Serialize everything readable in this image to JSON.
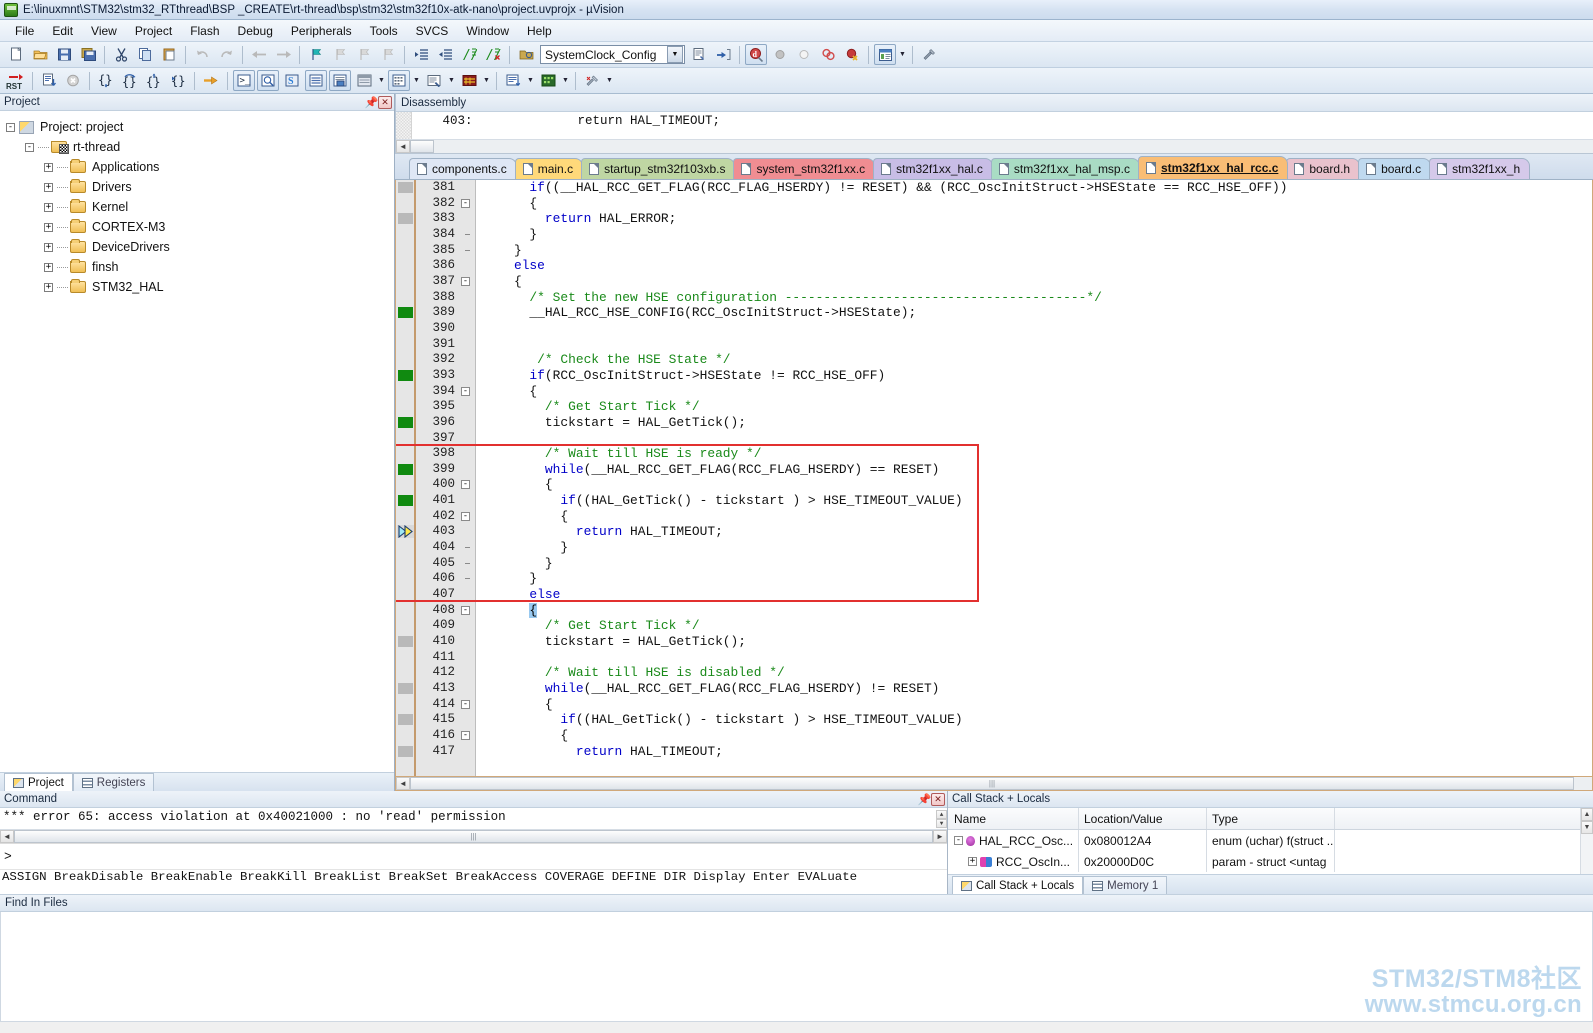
{
  "window": {
    "title": "E:\\linuxmnt\\STM32\\stm32_RTthread\\BSP _CREATE\\rt-thread\\bsp\\stm32\\stm32f10x-atk-nano\\project.uvprojx - µVision",
    "app_icon": "keil-uvision-icon"
  },
  "menu": [
    {
      "label": "File"
    },
    {
      "label": "Edit"
    },
    {
      "label": "View"
    },
    {
      "label": "Project"
    },
    {
      "label": "Flash"
    },
    {
      "label": "Debug"
    },
    {
      "label": "Peripherals"
    },
    {
      "label": "Tools"
    },
    {
      "label": "SVCS"
    },
    {
      "label": "Window"
    },
    {
      "label": "Help"
    }
  ],
  "toolbar": {
    "function_combo_value": "SystemClock_Config",
    "row1_icons": [
      "new-file-icon",
      "open-file-icon",
      "save-icon",
      "save-all-icon",
      "sep",
      "cut-icon",
      "copy-icon",
      "paste-icon",
      "sep",
      "undo-icon",
      "redo-icon",
      "sep",
      "navigate-back-icon",
      "navigate-forward-icon",
      "sep",
      "bookmark-toggle-icon",
      "bookmark-prev-icon",
      "bookmark-next-icon",
      "bookmark-clear-icon",
      "sep",
      "indent-icon",
      "outdent-icon",
      "comment-icon",
      "uncomment-icon"
    ],
    "row2_icons": [
      "reset-cpu-icon",
      "sep",
      "build-icon",
      "stop-build-icon",
      "sep",
      "step-into-icon",
      "step-over-icon",
      "step-out-icon",
      "run-to-cursor-icon",
      "sep",
      "show-next-statement-icon",
      "sep",
      "command-window-icon",
      "disassembly-window-icon",
      "symbols-window-icon",
      "registers-window-icon",
      "call-stack-window-icon",
      "watch-window-icon",
      "watch-caret",
      "memory-window-icon",
      "memory-caret",
      "serial-window-icon",
      "serial-caret",
      "analysis-window-icon",
      "analysis-caret"
    ],
    "right_icons": [
      "sep",
      "target-options-icon",
      "function-combo",
      "bookmark-list-icon",
      "go-to-definition-icon",
      "sep",
      "start-debug-icon",
      "insert-breakpoint-icon",
      "disable-breakpoint-icon",
      "kill-all-breakpoints-icon",
      "disable-all-breakpoints-icon",
      "sep",
      "manage-windows-icon",
      "manage-caret",
      "sep",
      "configure-icon"
    ]
  },
  "project_panel": {
    "title": "Project",
    "pin_icon": "pin-icon",
    "close_icon": "close-icon",
    "tree": [
      {
        "label": "Project: project",
        "depth": 0,
        "expander": "-",
        "icon": "project-icon"
      },
      {
        "label": "rt-thread",
        "depth": 1,
        "expander": "-",
        "icon": "target-icon"
      },
      {
        "label": "Applications",
        "depth": 2,
        "expander": "+",
        "icon": "folder-icon"
      },
      {
        "label": "Drivers",
        "depth": 2,
        "expander": "+",
        "icon": "folder-icon"
      },
      {
        "label": "Kernel",
        "depth": 2,
        "expander": "+",
        "icon": "folder-icon"
      },
      {
        "label": "CORTEX-M3",
        "depth": 2,
        "expander": "+",
        "icon": "folder-icon"
      },
      {
        "label": "DeviceDrivers",
        "depth": 2,
        "expander": "+",
        "icon": "folder-icon"
      },
      {
        "label": "finsh",
        "depth": 2,
        "expander": "+",
        "icon": "folder-icon"
      },
      {
        "label": "STM32_HAL",
        "depth": 2,
        "expander": "+",
        "icon": "folder-icon"
      }
    ],
    "tabs": [
      {
        "label": "Project",
        "active": true,
        "icon": "project-tab-icon"
      },
      {
        "label": "Registers",
        "active": false,
        "icon": "registers-tab-icon"
      }
    ]
  },
  "disassembly": {
    "title": "Disassembly",
    "line": "   403:              return HAL_TIMEOUT;"
  },
  "file_tabs": [
    {
      "label": "components.c",
      "color": "#dfe7f5",
      "active": false
    },
    {
      "label": "main.c",
      "color": "#ffd97a",
      "active": false
    },
    {
      "label": "startup_stm32f103xb.s",
      "color": "#bfd6a3",
      "active": false
    },
    {
      "label": "system_stm32f1xx.c",
      "color": "#f08d92",
      "active": false
    },
    {
      "label": "stm32f1xx_hal.c",
      "color": "#c8bde6",
      "active": false
    },
    {
      "label": "stm32f1xx_hal_msp.c",
      "color": "#a9dcc4",
      "active": false
    },
    {
      "label": "stm32f1xx_hal_rcc.c",
      "color": "#f9bd75",
      "active": true
    },
    {
      "label": "board.h",
      "color": "#e9c2cd",
      "active": false
    },
    {
      "label": "board.c",
      "color": "#bfd9ef",
      "active": false
    },
    {
      "label": "stm32f1xx_h",
      "color": "#d5c9ea",
      "active": false
    }
  ],
  "editor": {
    "highlight_box": {
      "label": "red-annotation-rectangle"
    },
    "lines": [
      {
        "num": 381,
        "marker": "grey",
        "fold": "none",
        "text": "      if((__HAL_RCC_GET_FLAG(RCC_FLAG_HSERDY) != RESET) && (RCC_OscInitStruct->HSEState == RCC_HSE_OFF))",
        "kw": "if"
      },
      {
        "num": 382,
        "marker": "none",
        "fold": "minus",
        "text": "      {"
      },
      {
        "num": 383,
        "marker": "grey",
        "fold": "none",
        "text": "        return HAL_ERROR;",
        "kw": "return"
      },
      {
        "num": 384,
        "marker": "none",
        "fold": "tick",
        "text": "      }"
      },
      {
        "num": 385,
        "marker": "none",
        "fold": "tick",
        "text": "    }"
      },
      {
        "num": 386,
        "marker": "none",
        "fold": "none",
        "text": "    else",
        "kw": "else"
      },
      {
        "num": 387,
        "marker": "none",
        "fold": "minus",
        "text": "    {"
      },
      {
        "num": 388,
        "marker": "none",
        "fold": "none",
        "text": "      /* Set the new HSE configuration ---------------------------------------*/",
        "comment": true
      },
      {
        "num": 389,
        "marker": "green",
        "fold": "none",
        "text": "      __HAL_RCC_HSE_CONFIG(RCC_OscInitStruct->HSEState);"
      },
      {
        "num": 390,
        "marker": "none",
        "fold": "none",
        "text": ""
      },
      {
        "num": 391,
        "marker": "none",
        "fold": "none",
        "text": ""
      },
      {
        "num": 392,
        "marker": "none",
        "fold": "none",
        "text": "       /* Check the HSE State */",
        "comment": true
      },
      {
        "num": 393,
        "marker": "green",
        "fold": "none",
        "text": "      if(RCC_OscInitStruct->HSEState != RCC_HSE_OFF)",
        "kw": "if"
      },
      {
        "num": 394,
        "marker": "none",
        "fold": "minus",
        "text": "      {"
      },
      {
        "num": 395,
        "marker": "none",
        "fold": "none",
        "text": "        /* Get Start Tick */",
        "comment": true
      },
      {
        "num": 396,
        "marker": "green",
        "fold": "none",
        "text": "        tickstart = HAL_GetTick();"
      },
      {
        "num": 397,
        "marker": "none",
        "fold": "none",
        "text": ""
      },
      {
        "num": 398,
        "marker": "none",
        "fold": "none",
        "text": "        /* Wait till HSE is ready */",
        "comment": true
      },
      {
        "num": 399,
        "marker": "green",
        "fold": "none",
        "text": "        while(__HAL_RCC_GET_FLAG(RCC_FLAG_HSERDY) == RESET)",
        "kw": "while"
      },
      {
        "num": 400,
        "marker": "none",
        "fold": "minus",
        "text": "        {"
      },
      {
        "num": 401,
        "marker": "green",
        "fold": "none",
        "text": "          if((HAL_GetTick() - tickstart ) > HSE_TIMEOUT_VALUE)",
        "kw": "if"
      },
      {
        "num": 402,
        "marker": "none",
        "fold": "minus",
        "text": "          {"
      },
      {
        "num": 403,
        "marker": "arrow",
        "fold": "none",
        "text": "            return HAL_TIMEOUT;",
        "kw": "return"
      },
      {
        "num": 404,
        "marker": "none",
        "fold": "tick",
        "text": "          }"
      },
      {
        "num": 405,
        "marker": "none",
        "fold": "tick",
        "text": "        }"
      },
      {
        "num": 406,
        "marker": "none",
        "fold": "tick",
        "text": "      }"
      },
      {
        "num": 407,
        "marker": "none",
        "fold": "none",
        "text": "      else",
        "kw": "else"
      },
      {
        "num": 408,
        "marker": "none",
        "fold": "minus",
        "text": "      {",
        "selected": true
      },
      {
        "num": 409,
        "marker": "none",
        "fold": "none",
        "text": "        /* Get Start Tick */",
        "comment": true
      },
      {
        "num": 410,
        "marker": "grey",
        "fold": "none",
        "text": "        tickstart = HAL_GetTick();"
      },
      {
        "num": 411,
        "marker": "none",
        "fold": "none",
        "text": ""
      },
      {
        "num": 412,
        "marker": "none",
        "fold": "none",
        "text": "        /* Wait till HSE is disabled */",
        "comment": true
      },
      {
        "num": 413,
        "marker": "grey",
        "fold": "none",
        "text": "        while(__HAL_RCC_GET_FLAG(RCC_FLAG_HSERDY) != RESET)",
        "kw": "while"
      },
      {
        "num": 414,
        "marker": "none",
        "fold": "minus",
        "text": "        {"
      },
      {
        "num": 415,
        "marker": "grey",
        "fold": "none",
        "text": "          if((HAL_GetTick() - tickstart ) > HSE_TIMEOUT_VALUE)",
        "kw": "if"
      },
      {
        "num": 416,
        "marker": "none",
        "fold": "minus",
        "text": "          {"
      },
      {
        "num": 417,
        "marker": "grey",
        "fold": "none",
        "text": "            return HAL_TIMEOUT;",
        "kw": "return"
      }
    ]
  },
  "command_panel": {
    "title": "Command",
    "pin_icon": "pin-icon",
    "close_icon": "close-icon",
    "output": "*** error 65: access violation at 0x40021000 : no 'read' permission",
    "prompt": ">",
    "keywords": "ASSIGN BreakDisable BreakEnable BreakKill BreakList BreakSet BreakAccess COVERAGE DEFINE DIR Display Enter EVALuate"
  },
  "call_stack_panel": {
    "title": "Call Stack + Locals",
    "columns": [
      "Name",
      "Location/Value",
      "Type"
    ],
    "rows": [
      {
        "name": "HAL_RCC_Osc...",
        "location": "0x080012A4",
        "type": "enum (uchar) f(struct ...",
        "expander": "-",
        "icon": "function-icon",
        "indent": 0
      },
      {
        "name": "RCC_OscIn...",
        "location": "0x20000D0C",
        "type": "param - struct <untag",
        "expander": "+",
        "icon": "param-icon",
        "indent": 1
      }
    ],
    "tabs": [
      {
        "label": "Call Stack + Locals",
        "active": true,
        "icon": "call-stack-icon"
      },
      {
        "label": "Memory 1",
        "active": false,
        "icon": "memory-icon"
      }
    ]
  },
  "find_in_files": {
    "title": "Find In Files"
  },
  "watermark": {
    "line1": "STM32/STM8社区",
    "line2": "www.stmcu.org.cn",
    "color": "#bcd8ee"
  }
}
